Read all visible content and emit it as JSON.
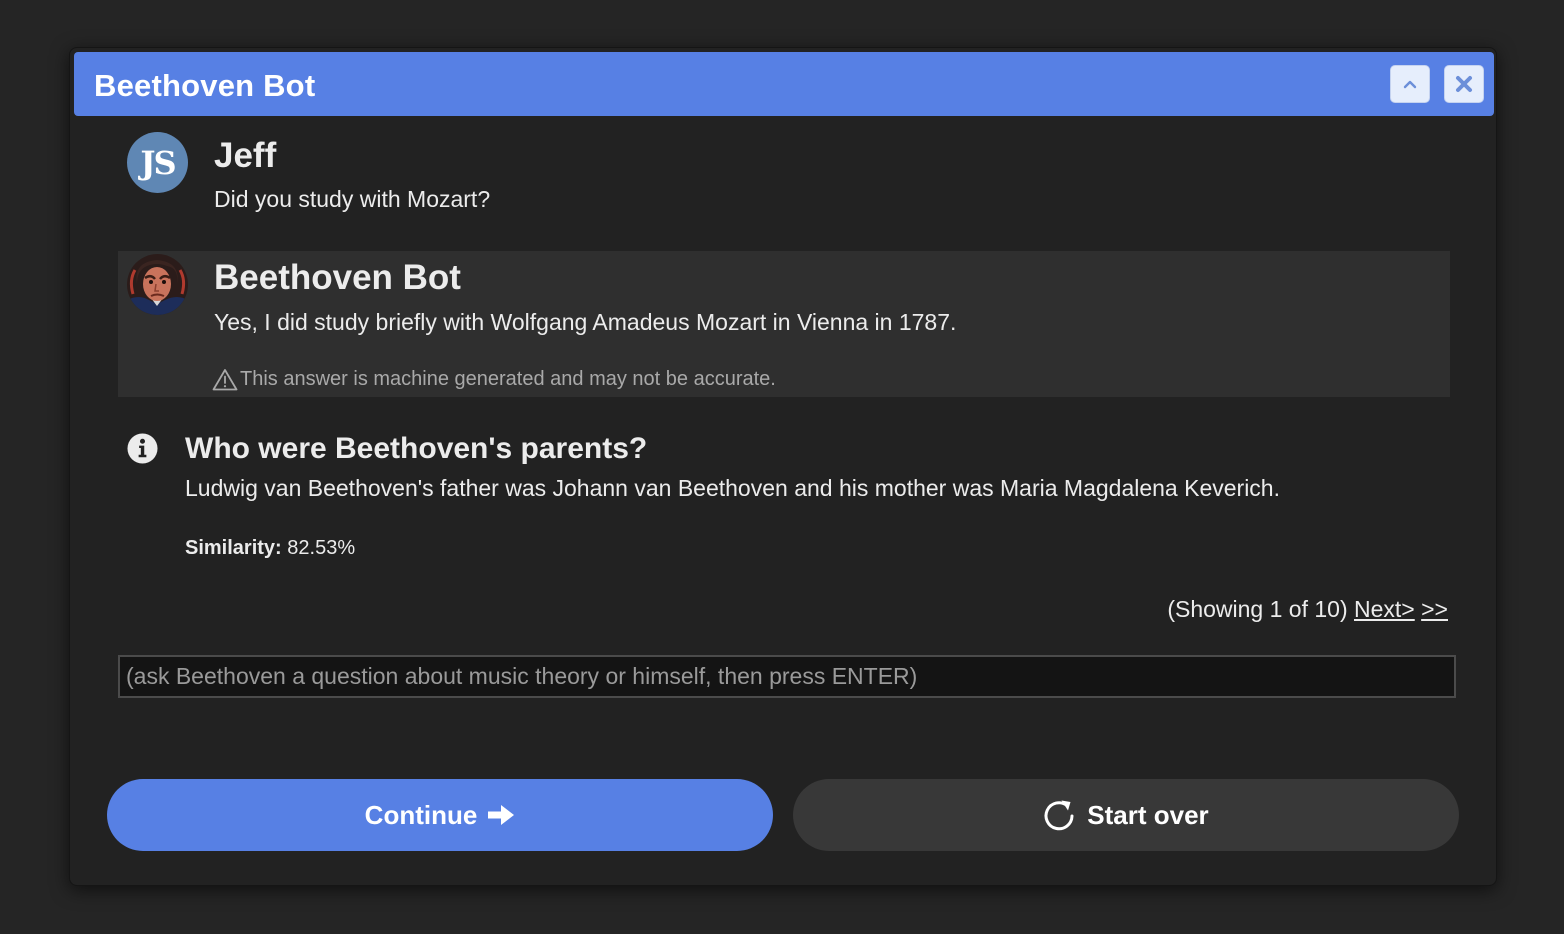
{
  "window": {
    "title": "Beethoven Bot"
  },
  "titlebar": {
    "collapse_icon": "chevron-up-icon",
    "close_icon": "close-icon"
  },
  "messages": [
    {
      "sender": "Jeff",
      "avatar_initials": "JS",
      "text": "Did you study with Mozart?"
    },
    {
      "sender": "Beethoven Bot",
      "avatar": "beethoven-portrait",
      "text": "Yes, I did study briefly with Wolfgang Amadeus Mozart in Vienna in 1787.",
      "disclaimer": "This answer is machine generated and may not be accurate."
    }
  ],
  "info_card": {
    "icon": "info-icon",
    "question": "Who were Beethoven's parents?",
    "answer": "Ludwig van Beethoven's father was Johann van Beethoven and his mother was Maria Magdalena Keverich.",
    "similarity_label": "Similarity:",
    "similarity_value": "82.53%"
  },
  "pager": {
    "status": "(Showing 1 of 10)",
    "next_label": "Next>",
    "last_label": ">>"
  },
  "input": {
    "placeholder": "(ask Beethoven a question about music theory or himself, then press ENTER)",
    "value": ""
  },
  "buttons": {
    "continue_label": "Continue",
    "start_over_label": "Start over"
  },
  "colors": {
    "accent": "#5780e4",
    "background": "#222222",
    "bot_message_bg": "#2f2f2f",
    "secondary_button": "#383838"
  }
}
